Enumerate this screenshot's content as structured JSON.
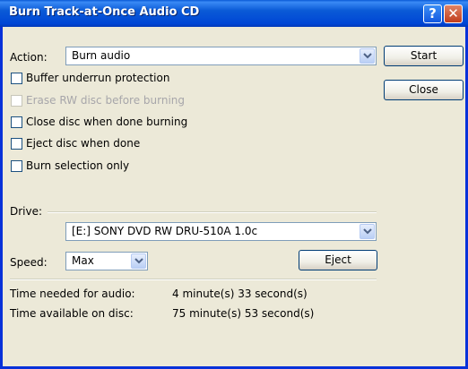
{
  "window": {
    "title": "Burn Track-at-Once Audio CD",
    "help_glyph": "?",
    "close_glyph": "✕"
  },
  "action": {
    "label": "Action:",
    "value": "Burn audio"
  },
  "buttons": {
    "start": "Start",
    "close": "Close",
    "eject": "Eject"
  },
  "options": [
    {
      "label": "Buffer underrun protection",
      "checked": false,
      "enabled": true
    },
    {
      "label": "Erase RW disc before burning",
      "checked": false,
      "enabled": false
    },
    {
      "label": "Close disc when done burning",
      "checked": false,
      "enabled": true
    },
    {
      "label": "Eject disc when done",
      "checked": false,
      "enabled": true
    },
    {
      "label": "Burn selection only",
      "checked": false,
      "enabled": true
    }
  ],
  "drive": {
    "label": "Drive:",
    "value": "[E:] SONY DVD RW DRU-510A 1.0c"
  },
  "speed": {
    "label": "Speed:",
    "value": "Max"
  },
  "info": {
    "needed_label": "Time needed for audio:",
    "needed_value": "4 minute(s) 33 second(s)",
    "available_label": "Time available on disc:",
    "available_value": "75 minute(s) 53 second(s)"
  }
}
